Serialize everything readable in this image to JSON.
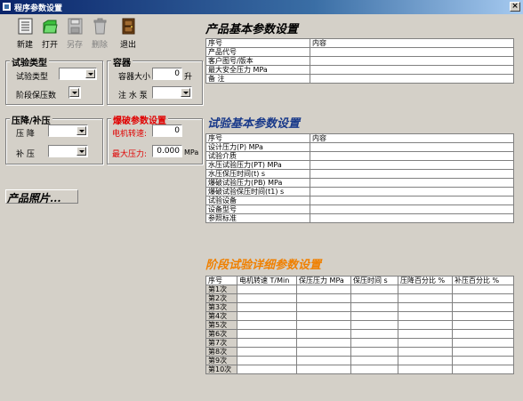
{
  "window": {
    "title": "程序参数设置",
    "close_glyph": "×"
  },
  "toolbar": {
    "new_label": "新建",
    "open_label": "打开",
    "save_label": "另存",
    "delete_label": "删除",
    "exit_label": "退出"
  },
  "test_type_group": {
    "title": "试验类型",
    "type_label": "试验类型",
    "stage_pressure_label": "阶段保压数"
  },
  "vessel_group": {
    "title": "容器",
    "size_label": "容器大小",
    "size_value": "0",
    "size_unit": "升",
    "pump_label": "注 水 泵"
  },
  "pressure_group": {
    "title": "压降/补压",
    "drop_label": "压 降",
    "supplement_label": "补 压"
  },
  "burst_group": {
    "title": "爆破参数设置",
    "motor_label": "电机转速:",
    "motor_value": "0",
    "max_pressure_label": "最大压力:",
    "max_pressure_value": "0.000",
    "max_pressure_unit": "MPa"
  },
  "product_photo_label": "产品照片...",
  "product_section": {
    "title": "产品基本参数设置",
    "header": [
      "序号",
      "内容"
    ],
    "rows": [
      "产品代号",
      "客户图号/版本",
      "最大安全压力 MPa",
      "备    注"
    ]
  },
  "test_section": {
    "title": "试验基本参数设置",
    "header": [
      "序号",
      "内容"
    ],
    "rows": [
      "设计压力(P) MPa",
      "试验介质",
      "水压试验压力(PT) MPa",
      "水压保压时间(t) s",
      "爆破试验压力(PB) MPa",
      "爆破试验保压时间(t1) s",
      "试验设备",
      "设备型号",
      "参照标准"
    ]
  },
  "stage_section": {
    "title": "阶段试验详细参数设置",
    "header": [
      "序号",
      "电机转速 T/Min",
      "保压压力 MPa",
      "保压时间 s",
      "压降百分比 %",
      "补压百分比 %"
    ],
    "rows": [
      "第1次",
      "第2次",
      "第3次",
      "第4次",
      "第5次",
      "第6次",
      "第7次",
      "第8次",
      "第9次",
      "第10次"
    ]
  },
  "colors": {
    "title_bar": "#0a246a",
    "window_bg": "#d4d0c8",
    "test_title": "#1a3a8a",
    "stage_title": "#f08000",
    "burst_title": "#e00000"
  }
}
